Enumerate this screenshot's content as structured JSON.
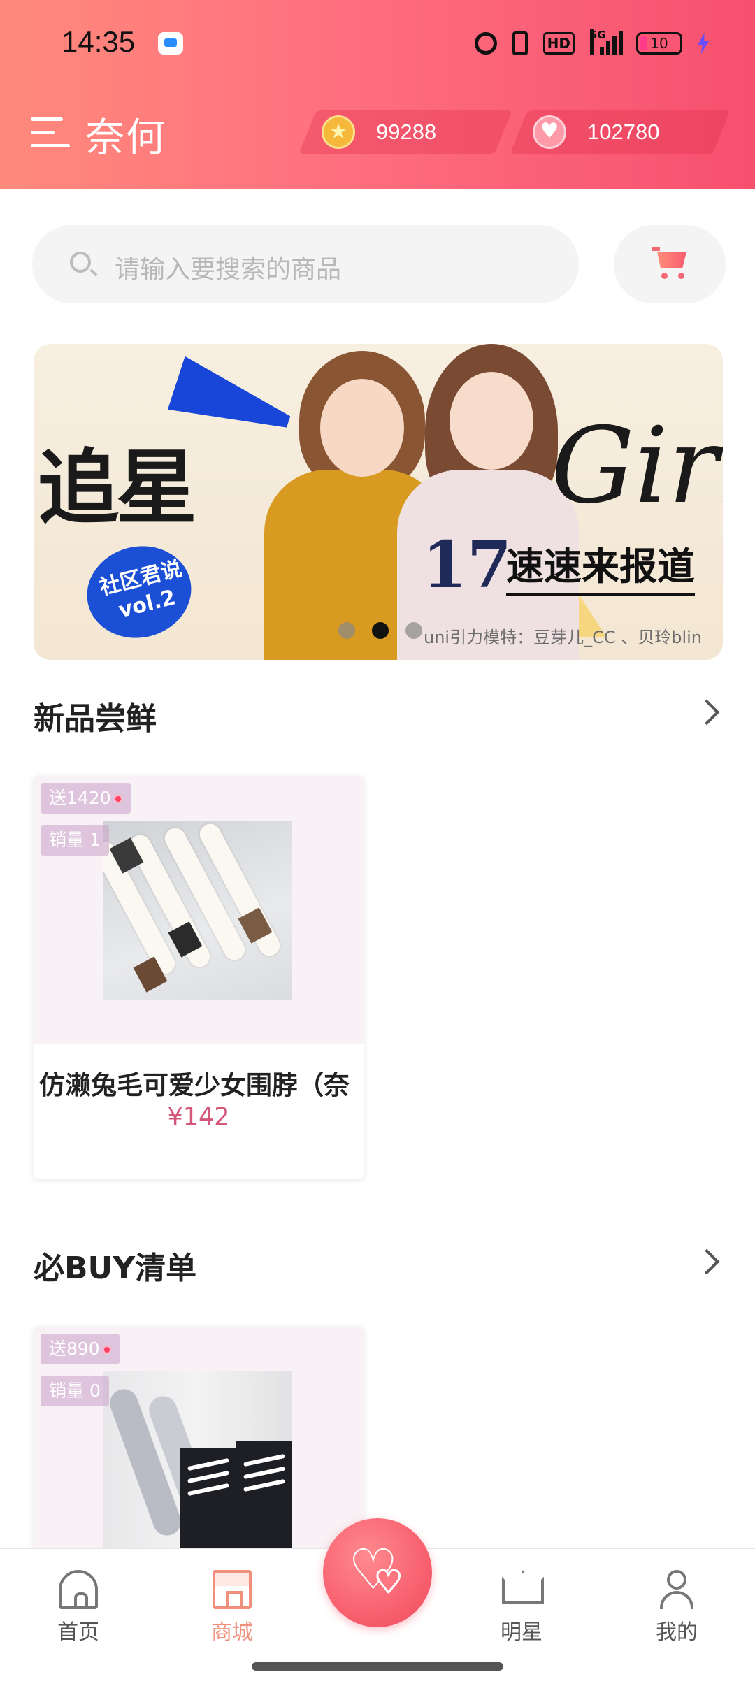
{
  "status_bar": {
    "time": "14:35",
    "network": "5G",
    "hd_label": "HD",
    "battery_level": "10"
  },
  "header": {
    "title": "奈何",
    "coins": "99288",
    "hearts": "102780"
  },
  "search": {
    "placeholder": "请输入要搜索的商品"
  },
  "banner": {
    "headline": "追星",
    "script_text": "Girl",
    "subtitle": "速速来报道",
    "badge_text": "社区君说vol.2",
    "number_print": "17",
    "credit": "uni引力模特：豆芽儿_CC 、贝玲blin",
    "active_slide": 2,
    "total_slides": 3
  },
  "sections": [
    {
      "title": "新品尝鲜",
      "products": [
        {
          "gift_tag": "送1420",
          "sales_tag": "销量 1",
          "name": "仿濑兔毛可爱少女围脖（奈",
          "price": "¥142"
        }
      ]
    },
    {
      "title": "必BUY清单",
      "products": [
        {
          "gift_tag": "送890",
          "sales_tag": "销量 0"
        }
      ]
    }
  ],
  "bottom_nav": {
    "items": [
      {
        "label": "首页",
        "icon": "home-icon"
      },
      {
        "label": "商城",
        "icon": "shop-icon",
        "active": true
      },
      {
        "label": "",
        "icon": "heart-fab-icon"
      },
      {
        "label": "明星",
        "icon": "crown-icon"
      },
      {
        "label": "我的",
        "icon": "user-icon"
      }
    ]
  },
  "colors": {
    "header_gradient_start": "#ff8a7c",
    "header_gradient_end": "#f6506f",
    "price": "#d4577a",
    "active_nav": "#f08f7c"
  }
}
